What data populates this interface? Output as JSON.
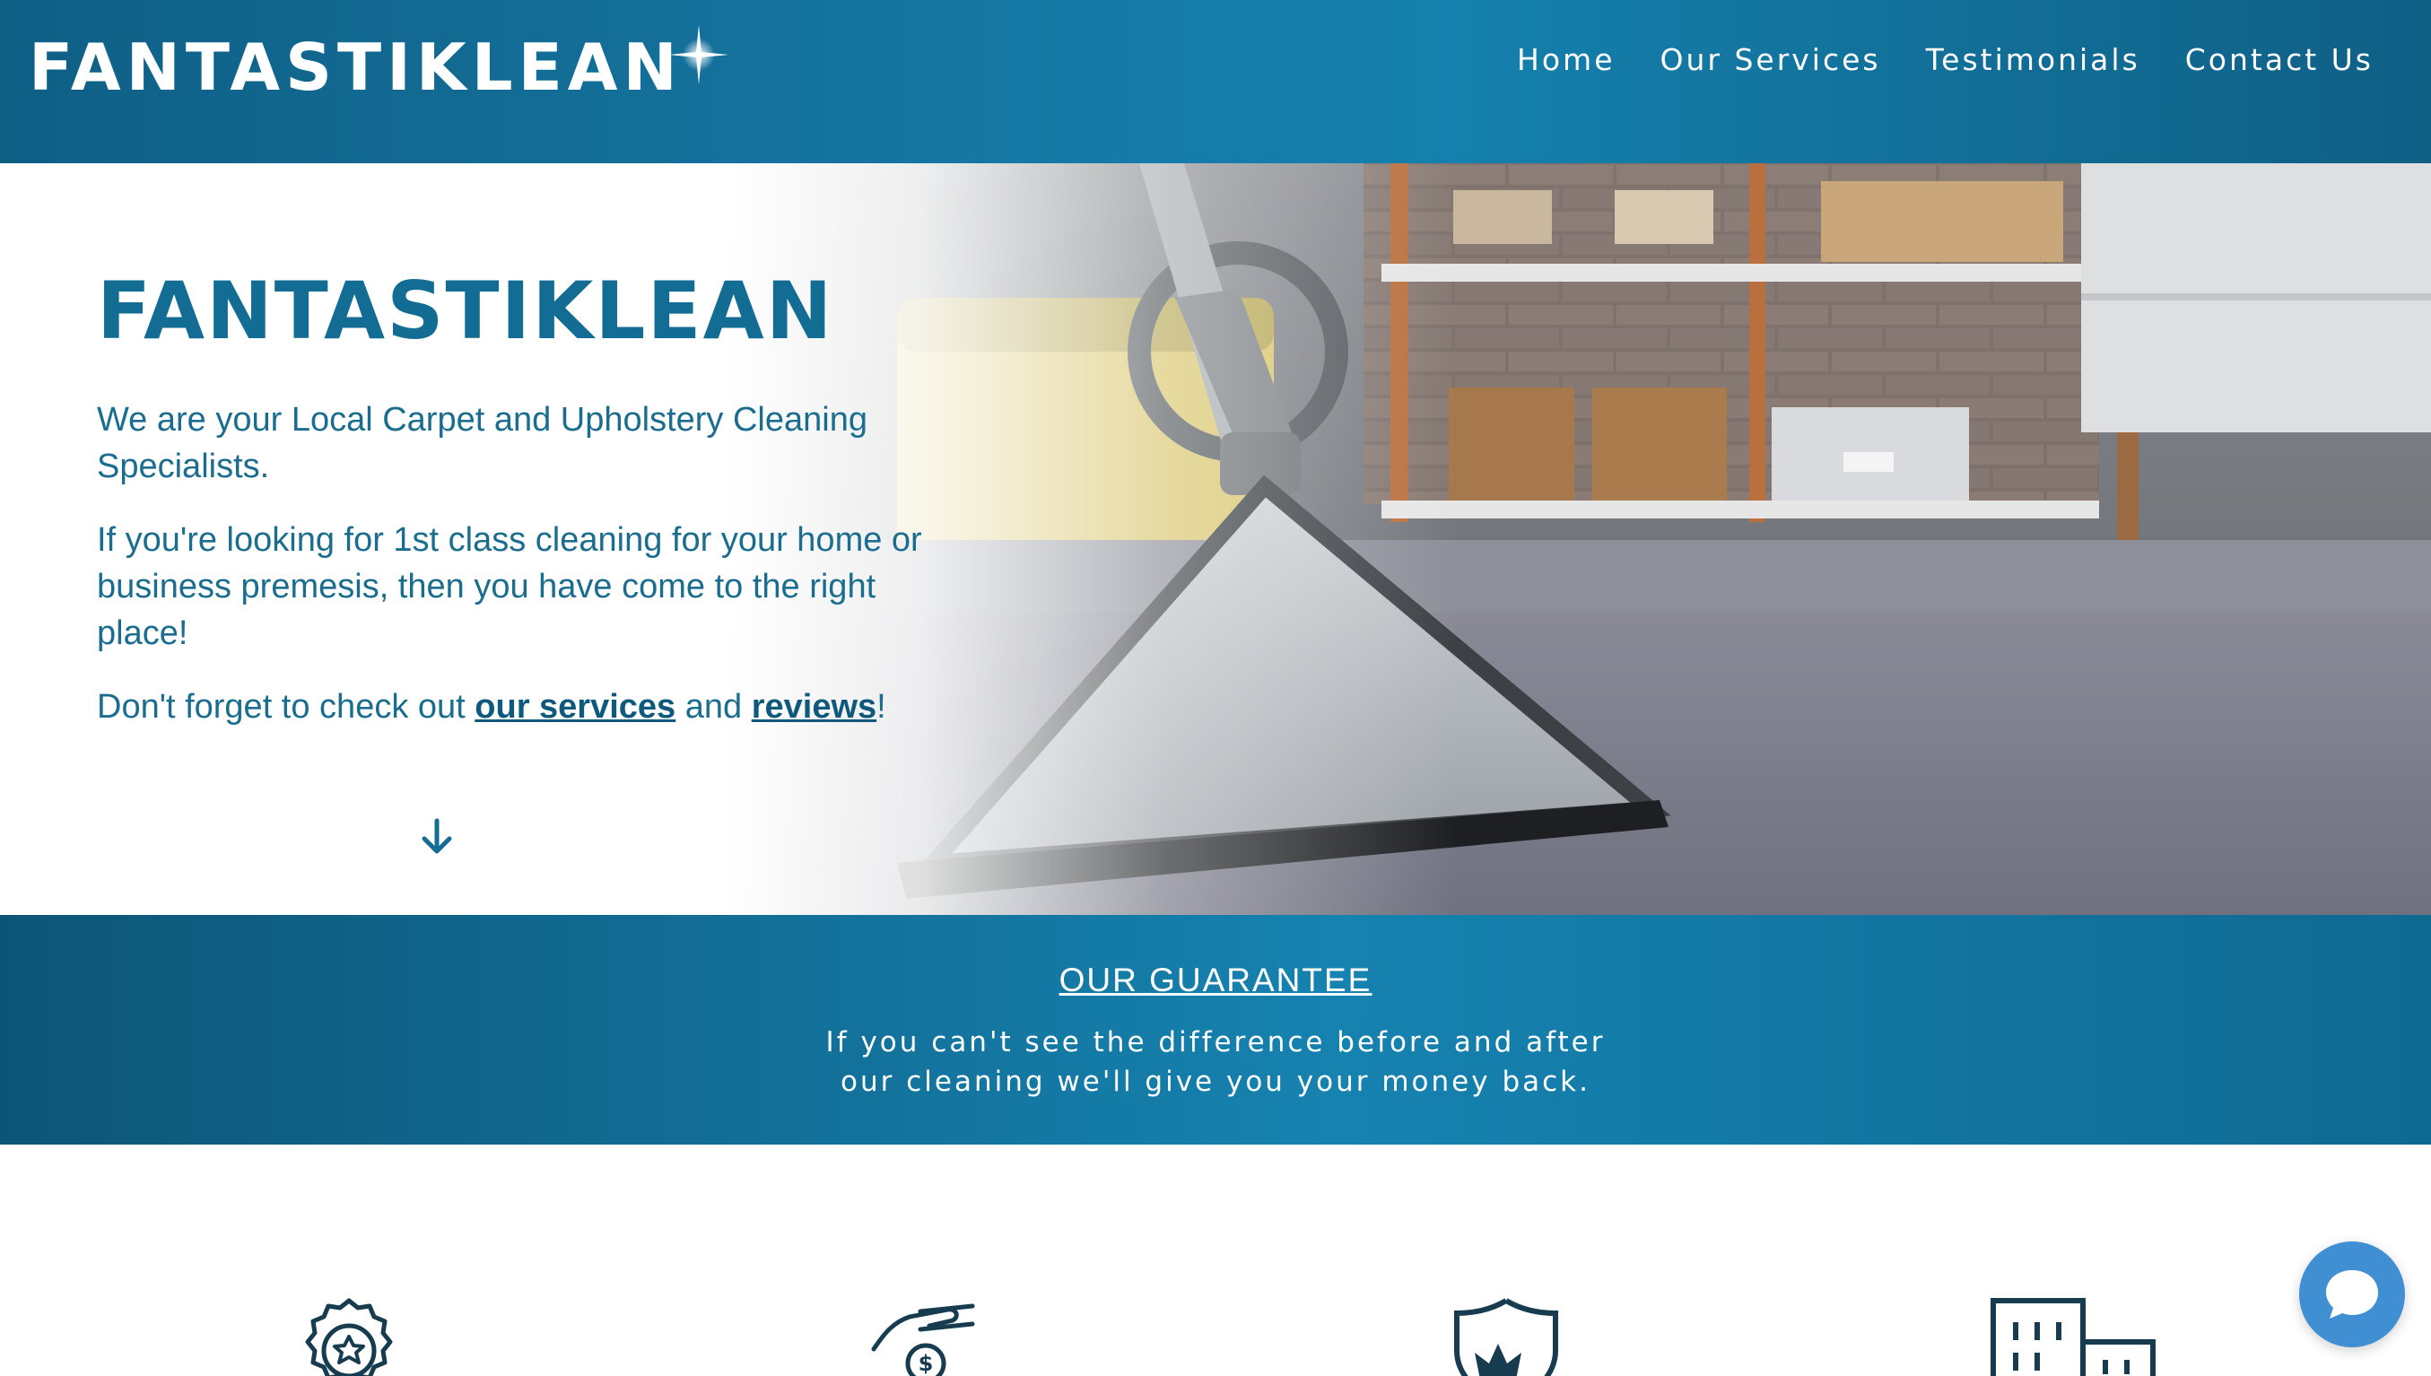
{
  "header": {
    "logo_text": "FANTASTIKLEAN",
    "nav": [
      {
        "label": "Home"
      },
      {
        "label": "Our Services"
      },
      {
        "label": "Testimonials"
      },
      {
        "label": "Contact Us"
      }
    ]
  },
  "hero": {
    "title": "FANTASTIKLEAN",
    "paragraph1": "We are your Local Carpet and Upholstery Cleaning Specialists.",
    "paragraph2": "If you're looking for 1st class cleaning for your home or business premesis, then you have come to the right place!",
    "paragraph3_prefix": "Don't forget to check out ",
    "link_services": "our services",
    "paragraph3_middle": " and ",
    "link_reviews": "reviews",
    "paragraph3_suffix": "!",
    "scroll_icon": "arrow-down-icon"
  },
  "guarantee": {
    "title": "OUR GUARANTEE",
    "line1": "If you can't see the difference before and after",
    "line2": "our cleaning we'll give you your money back."
  },
  "features": {
    "icons": [
      "award-badge-icon",
      "hand-money-icon",
      "shield-crown-icon",
      "building-icon"
    ]
  },
  "chat": {
    "icon": "chat-bubble-icon"
  },
  "colors": {
    "brand_blue": "#136c93",
    "header_blue": "#167aa6",
    "chat_blue": "#3f8fd2"
  }
}
